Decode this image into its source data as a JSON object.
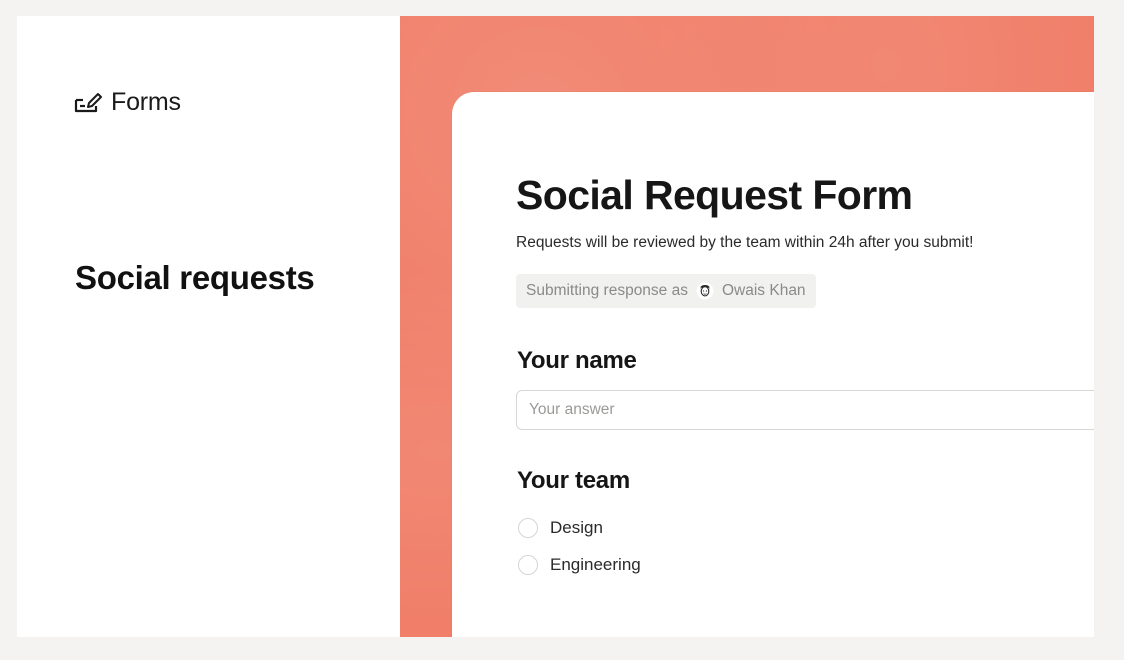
{
  "sidebar": {
    "brand_label": "Forms",
    "brand_icon": "form-pencil-icon",
    "page_title": "Social requests"
  },
  "form": {
    "title": "Social Request Form",
    "description": "Requests will be reviewed by the team within 24h after you submit!",
    "respondent_prefix": "Submitting response as",
    "respondent_name": "Owais Khan",
    "questions": [
      {
        "label": "Your name",
        "type": "text",
        "placeholder": "Your answer",
        "value": ""
      },
      {
        "label": "Your team",
        "type": "single-choice",
        "options": [
          "Design",
          "Engineering"
        ],
        "selected": null
      }
    ]
  },
  "colors": {
    "page_background": "#f4f3f1",
    "panel_background": "#ffffff",
    "accent_coral": "#f07e68",
    "text_primary": "#161616",
    "text_muted": "#8a8a87",
    "chip_background": "#f1f1ef",
    "input_border": "#d7d7d4"
  }
}
